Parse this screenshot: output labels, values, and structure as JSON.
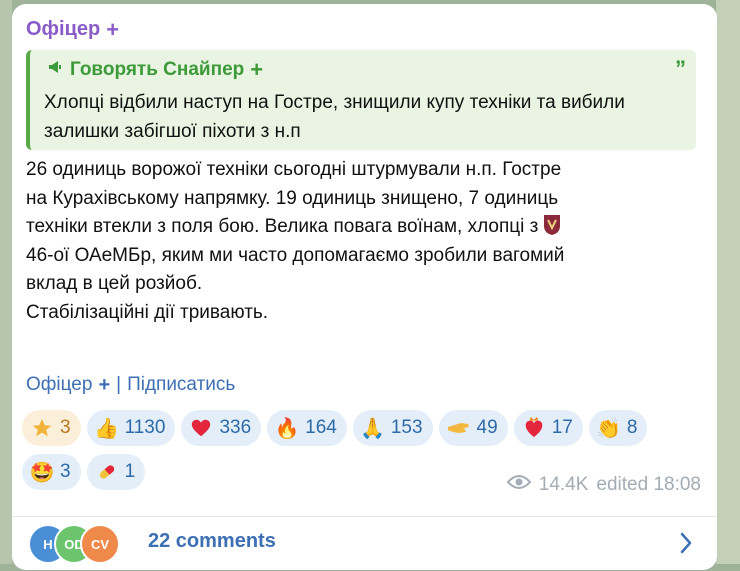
{
  "channel": {
    "name": "Офіцер",
    "plus_icon": "plus-icon"
  },
  "quote": {
    "author": "Говорять Снайпер",
    "quote_mark": "”",
    "text": "Хлопці відбили наступ на Гостре, знищили купу техніки та вибили залишки забігшої піхоти з н.п"
  },
  "post": {
    "lines": [
      "26 одиниць ворожої техніки сьогодні штурмували н.п. Гостре",
      "на Курахівському напрямку. 19 одиниць знищено, 7 одиниць",
      "техніки втекли з поля бою. Велика повага воїнам, хлопці з",
      "46-ої ОАеМБр, яким ми часто допомагаємо зробили вагомий",
      "вклад в цей розйоб.",
      "Стабілізаційні дії тривають."
    ]
  },
  "links": {
    "channel_label": "Офіцер",
    "separator": "|",
    "subscribe_label": "Підписатись"
  },
  "reactions": [
    {
      "icon": "star-icon",
      "count": "3"
    },
    {
      "icon": "thumbs-up-icon",
      "count": "1130"
    },
    {
      "icon": "heart-icon",
      "count": "336"
    },
    {
      "icon": "fire-icon",
      "count": "164"
    },
    {
      "icon": "pray-icon",
      "count": "153"
    },
    {
      "icon": "hand-icon",
      "count": "49"
    },
    {
      "icon": "heart-on-fire-icon",
      "count": "17"
    },
    {
      "icon": "clap-icon",
      "count": "8"
    },
    {
      "icon": "star-struck-icon",
      "count": "3"
    },
    {
      "icon": "pill-icon",
      "count": "1"
    }
  ],
  "meta": {
    "views": "14.4K",
    "edited": "edited 18:08"
  },
  "footer": {
    "avatars": [
      {
        "initials": "H",
        "color": "#4a8fd6"
      },
      {
        "initials": "OD",
        "color": "#6cc46c"
      },
      {
        "initials": "CV",
        "color": "#f08a4b"
      }
    ],
    "comments_label": "22 comments"
  },
  "colors": {
    "channel_name": "#8a5cc7",
    "quote_accent": "#3d9a39",
    "link": "#3d6fb5",
    "reaction_bg": "#e3eef9",
    "meta": "#a3acb4"
  }
}
